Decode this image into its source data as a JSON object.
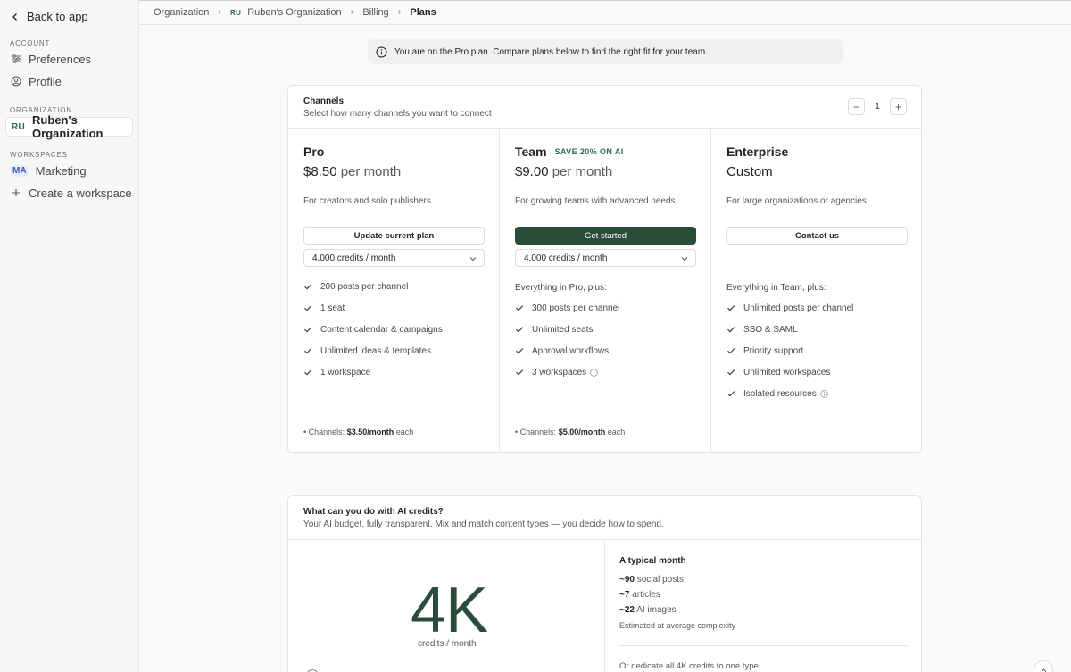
{
  "sidebar": {
    "back_label": "Back to app",
    "sections": {
      "account": "ACCOUNT",
      "organization": "ORGANIZATION",
      "workspaces": "WORKSPACES"
    },
    "account_items": [
      {
        "label": "Preferences",
        "icon": "sliders-icon"
      },
      {
        "label": "Profile",
        "icon": "user-circle-icon"
      }
    ],
    "organization_item": {
      "badge": "RU",
      "label": "Ruben's Organization"
    },
    "workspace_items": [
      {
        "badge": "MA",
        "label": "Marketing"
      }
    ],
    "create_workspace_label": "Create a workspace"
  },
  "breadcrumb": {
    "items": [
      "Organization",
      "Ruben's Organization",
      "Billing"
    ],
    "org_badge": "RU",
    "current": "Plans"
  },
  "notice": {
    "text": "You are on the Pro plan. Compare plans below to find the right fit for your team."
  },
  "channels": {
    "title": "Channels",
    "subtitle": "Select how many channels you want to connect",
    "minus": "−",
    "plus": "+",
    "value": "1"
  },
  "plans": [
    {
      "name": "Pro",
      "badge": "",
      "price": "$8.50",
      "price_suffix": "per month",
      "description": "For creators and solo publishers",
      "button_label": "Update current plan",
      "credits_select": "4,000 credits / month",
      "intro": "",
      "features": [
        {
          "text": "200 posts per channel",
          "info": false
        },
        {
          "text": "1 seat",
          "info": false
        },
        {
          "text": "Content calendar & campaigns",
          "info": false
        },
        {
          "text": "Unlimited ideas & templates",
          "info": false
        },
        {
          "text": "1 workspace",
          "info": false
        }
      ],
      "channel_note_prefix": "Channels:",
      "channel_note_price": "$3.50/month",
      "channel_note_suffix": "each"
    },
    {
      "name": "Team",
      "badge": "SAVE 20% ON AI",
      "price": "$9.00",
      "price_suffix": "per month",
      "description": "For growing teams with advanced needs",
      "button_label": "Get started",
      "credits_select": "4,000 credits / month",
      "intro": "Everything in Pro, plus:",
      "features": [
        {
          "text": "300 posts per channel",
          "info": false
        },
        {
          "text": "Unlimited seats",
          "info": false
        },
        {
          "text": "Approval workflows",
          "info": false
        },
        {
          "text": "3 workspaces",
          "info": true
        }
      ],
      "channel_note_prefix": "Channels:",
      "channel_note_price": "$5.00/month",
      "channel_note_suffix": "each"
    },
    {
      "name": "Enterprise",
      "badge": "",
      "price": "Custom",
      "price_suffix": "",
      "description": "For large organizations or agencies",
      "button_label": "Contact us",
      "intro": "Everything in Team, plus:",
      "features": [
        {
          "text": "Unlimited posts per channel",
          "info": false
        },
        {
          "text": "SSO & SAML",
          "info": false
        },
        {
          "text": "Priority support",
          "info": false
        },
        {
          "text": "Unlimited workspaces",
          "info": false
        },
        {
          "text": "Isolated resources",
          "info": true
        }
      ]
    }
  ],
  "credits": {
    "title": "What can you do with AI credits?",
    "subtitle": "Your AI budget, fully transparent. Mix and match content types — you decide how to spend.",
    "big_number": "4K",
    "big_sub": "credits / month",
    "typical_title": "A typical month",
    "typical_items": [
      {
        "num": "~90",
        "label": "social posts"
      },
      {
        "num": "~7",
        "label": "articles"
      },
      {
        "num": "~22",
        "label": "AI images"
      }
    ],
    "estimate_note": "Estimated at average complexity",
    "dedicate_text": "Or dedicate all 4K credits to one type"
  },
  "colors": {
    "accent": "#2a4d3a",
    "badge_green": "#2f6f4f",
    "workspace_badge": "#3a5fae"
  }
}
